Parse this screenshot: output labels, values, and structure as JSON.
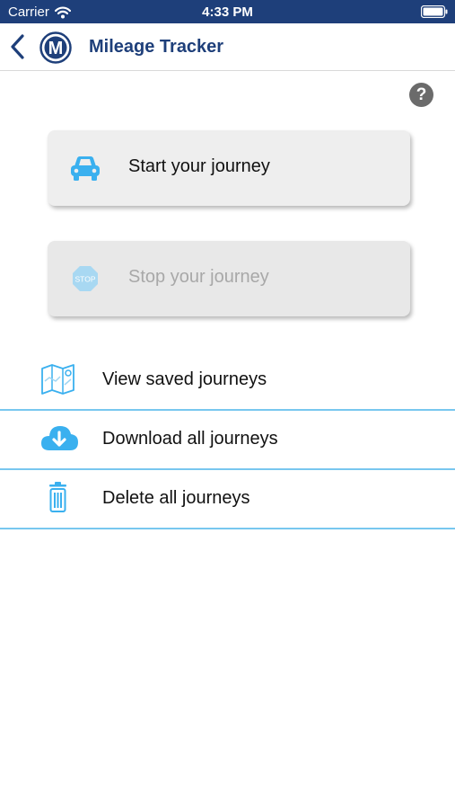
{
  "status_bar": {
    "carrier": "Carrier",
    "time": "4:33 PM"
  },
  "nav": {
    "title": "Mileage Tracker",
    "logo_letter": "M"
  },
  "help": {
    "label": "?"
  },
  "actions": {
    "start_label": "Start your journey",
    "stop_label": "Stop your journey",
    "stop_icon_text": "STOP"
  },
  "menu": {
    "items": [
      {
        "label": "View saved journeys",
        "icon": "map-icon"
      },
      {
        "label": "Download all journeys",
        "icon": "cloud-download-icon"
      },
      {
        "label": "Delete all journeys",
        "icon": "trash-icon"
      }
    ]
  },
  "colors": {
    "status_bar": "#1e3f7a",
    "title": "#1e3f7a",
    "accent": "#3ab0ef",
    "divider": "#78c7ef",
    "disabled_text": "#a8a8a8"
  }
}
